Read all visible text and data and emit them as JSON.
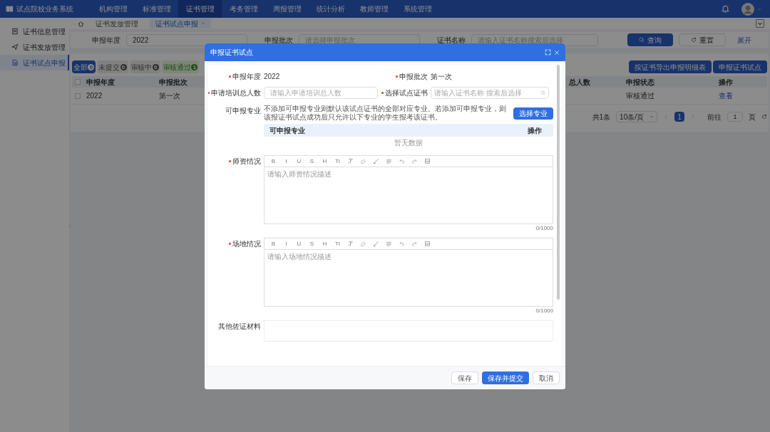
{
  "app": {
    "title": "试点院校业务系统"
  },
  "nav": [
    {
      "label": "机构管理",
      "selected": false
    },
    {
      "label": "标准管理",
      "selected": false
    },
    {
      "label": "证书管理",
      "selected": true
    },
    {
      "label": "考务管理",
      "selected": false
    },
    {
      "label": "周报管理",
      "selected": false
    },
    {
      "label": "统计分析",
      "selected": false
    },
    {
      "label": "教师管理",
      "selected": false
    },
    {
      "label": "系统管理",
      "selected": false
    }
  ],
  "sidebar": [
    {
      "label": "证书信息管理",
      "kind": "info",
      "selected": false
    },
    {
      "label": "证书发放管理",
      "kind": "send",
      "selected": false
    },
    {
      "label": "证书试点申报",
      "kind": "doc",
      "selected": true
    }
  ],
  "page_tabs": [
    {
      "label": "证书发放管理",
      "selected": false
    },
    {
      "label": "证书试点申报",
      "selected": true
    }
  ],
  "filters": [
    {
      "label": "申报年度",
      "value": "2022"
    },
    {
      "label": "申报批次",
      "placeholder": "请选择申报批次"
    },
    {
      "label": "证书名称",
      "placeholder": "请输入证书名称搜索后选择"
    }
  ],
  "search_buttons": [
    {
      "label": "查询",
      "kind": "primary"
    },
    {
      "label": "重置",
      "kind": "plain"
    },
    {
      "label": "展开",
      "kind": "link"
    }
  ],
  "status_tabs": [
    {
      "label": "全部",
      "count": "0",
      "selected": true,
      "kind": "neutral"
    },
    {
      "label": "未提交",
      "count": "0",
      "selected": false,
      "kind": "neutral"
    },
    {
      "label": "审核中",
      "count": "0",
      "selected": false,
      "kind": "neutral"
    },
    {
      "label": "审核通过",
      "count": "1",
      "selected": false,
      "kind": "success"
    }
  ],
  "actions": [
    "按证书导出申报明细表",
    "申报证书试点"
  ],
  "table": {
    "select_all_checked": false,
    "columns": [
      "申报年度",
      "申报批次",
      "总人数",
      "申报状态",
      "操作"
    ],
    "rows": [
      {
        "checked": false,
        "cells": [
          "2022",
          "第一次",
          "",
          "审核通过",
          "查看"
        ]
      }
    ]
  },
  "pagination": {
    "total": "共1条",
    "page_size": "10条/页",
    "pages": [
      {
        "label": "1",
        "selected": true
      }
    ],
    "goto_label": "前往",
    "goto_value": "1",
    "goto_suffix": "页"
  },
  "dialog": {
    "title": "申报证书试点",
    "year": {
      "label": "申报年度",
      "value": "2022"
    },
    "batch": {
      "label": "申报批次",
      "value": "第一次"
    },
    "trainees": {
      "label": "申请培训总人数",
      "placeholder": "请输入申请培训总人数"
    },
    "certificate": {
      "label": "选择试点证书",
      "placeholder": "请输入证书名称 搜索后选择"
    },
    "majors": {
      "label": "可申报专业",
      "note": "不添加可申报专业则默认该试点证书的全部对应专业。若添加可申报专业，则该报证书试点成功后只允许以下专业的学生报考该证书。",
      "button": "选择专业",
      "columns": [
        "可申报专业",
        "操作"
      ],
      "empty": "暂无数据"
    },
    "editors": [
      {
        "label": "师资情况",
        "placeholder": "请输入师资情况描述",
        "counter": "0/1000",
        "toolbar": [
          {
            "kind": "letter",
            "label": "B"
          },
          {
            "kind": "letter",
            "label": "I"
          },
          {
            "kind": "letter",
            "label": "U"
          },
          {
            "kind": "letter",
            "label": "S"
          },
          {
            "kind": "letter",
            "label": "H"
          },
          {
            "kind": "letter",
            "label": "TI"
          },
          {
            "kind": "clear"
          },
          {
            "kind": "eraser"
          },
          {
            "kind": "brush"
          },
          {
            "kind": "align"
          },
          {
            "kind": "undo"
          },
          {
            "kind": "redo"
          },
          {
            "kind": "table"
          }
        ]
      },
      {
        "label": "场地情况",
        "placeholder": "请输入场地情况描述",
        "counter": "0/1000",
        "toolbar": [
          {
            "kind": "letter",
            "label": "B"
          },
          {
            "kind": "letter",
            "label": "I"
          },
          {
            "kind": "letter",
            "label": "U"
          },
          {
            "kind": "letter",
            "label": "S"
          },
          {
            "kind": "letter",
            "label": "H"
          },
          {
            "kind": "letter",
            "label": "TI"
          },
          {
            "kind": "clear"
          },
          {
            "kind": "eraser"
          },
          {
            "kind": "brush"
          },
          {
            "kind": "align"
          },
          {
            "kind": "undo"
          },
          {
            "kind": "redo"
          },
          {
            "kind": "table"
          }
        ]
      }
    ],
    "evidence": {
      "label": "其他佐证材料"
    },
    "buttons": [
      {
        "label": "保存",
        "kind": "plain"
      },
      {
        "label": "保存并提交",
        "kind": "primary"
      },
      {
        "label": "取消",
        "kind": "plain"
      }
    ]
  }
}
